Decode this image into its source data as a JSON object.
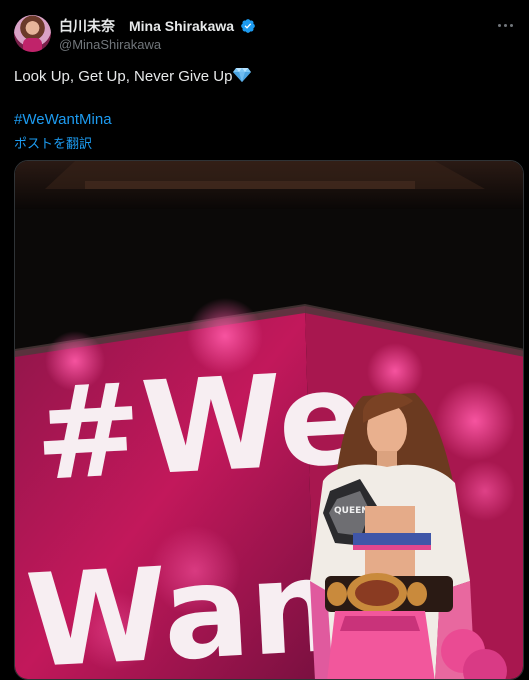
{
  "header": {
    "display_name": "白川未奈　Mina Shirakawa",
    "handle": "@MinaShirakawa",
    "verified": true,
    "verified_color": "#1d9bf0"
  },
  "post": {
    "text": "Look Up, Get Up, Never Give Up",
    "text_emoji": "diamond-icon",
    "hashtag": "#WeWantMina",
    "translate_label": "ポストを翻訳"
  },
  "media": {
    "sign_text_line1": "#We",
    "sign_text_line2": "Want",
    "belt_text": "QUEEN"
  },
  "colors": {
    "background": "#000000",
    "text": "#e7e9ea",
    "secondary": "#71767b",
    "link": "#1d9bf0",
    "sign_pink": "#c2185b"
  }
}
